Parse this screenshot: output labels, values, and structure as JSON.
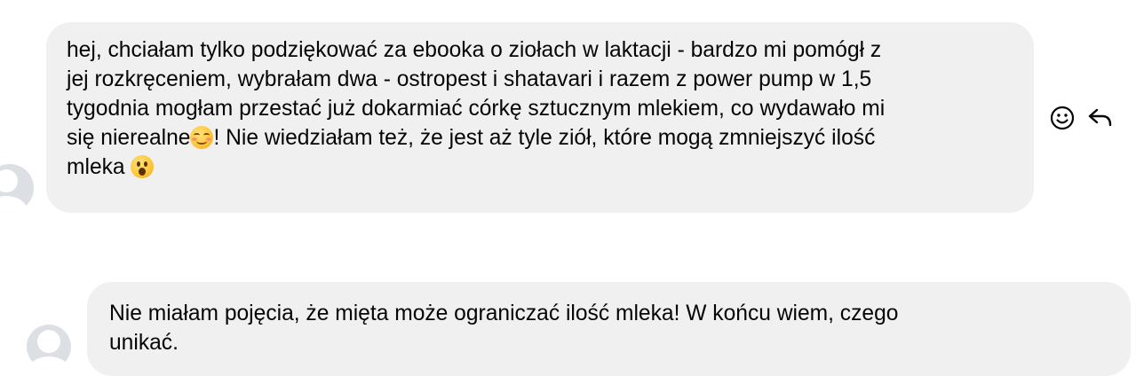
{
  "messages": [
    {
      "lines": [
        "hej, chciałam tylko podziękować za ebooka o ziołach w laktacji - bardzo mi pomógł z",
        "jej rozkręceniem, wybrałam dwa - ostropest i shatavari i razem z power pump w 1,5",
        "tygodnia mogłam przestać już dokarmiać córkę sztucznym mlekiem, co wydawało mi",
        "się nierealne",
        "! Nie wiedziałam też, że jest aż tyle ziół, które mogą zmniejszyć ilość",
        "mleka "
      ],
      "emojis": [
        "smiling-face-emoji",
        "astonished-face-emoji"
      ]
    },
    {
      "lines": [
        "Nie miałam pojęcia, że mięta może ograniczać ilość mleka! W końcu wiem, czego",
        "unikać."
      ]
    }
  ],
  "actions": {
    "react_icon": "smiley-icon",
    "reply_icon": "reply-arrow-icon"
  },
  "colors": {
    "bubble_bg": "#f0f0f0",
    "avatar_bg": "#dcdfe4",
    "text": "#050505",
    "icon": "#050505"
  }
}
